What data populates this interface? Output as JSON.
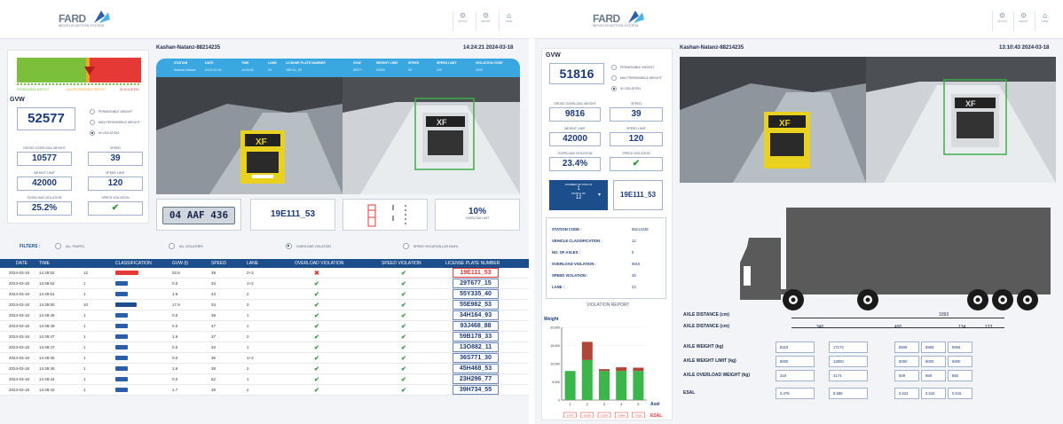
{
  "left": {
    "logo": {
      "word": "FARD",
      "sub": "WEIGH IN MOTION SYSTEM"
    },
    "nav": [
      {
        "label": "SETTING",
        "icon": "gear-icon"
      },
      {
        "label": "REPORT",
        "icon": "gear-icon"
      },
      {
        "label": "HOME",
        "icon": "home-icon"
      }
    ],
    "station_name": "Kashan-Natanz-88214235",
    "datetime": "14:24:21 2024-03-18",
    "scale": {
      "permissible": "PERMISSIBLE WEIGHT",
      "max": "MAX PERMISSIBLE WEIGHT",
      "violation": "IN VIOLATION"
    },
    "gvw_label": "GVW",
    "gvw": "52577",
    "legend": [
      "PERMISSIBLE WEIGHT",
      "MAX PERMISSIBLE WEIGHT",
      "IN VIOLATION"
    ],
    "stats": [
      {
        "label": "GROSS OVERLOAD WEIGHT",
        "value": "10577"
      },
      {
        "label": "SPEED",
        "value": "39"
      },
      {
        "label": "WEIGHT LIMIT",
        "value": "42000"
      },
      {
        "label": "SPEED LIMIT",
        "value": "120"
      },
      {
        "label": "OVERLOAD VIOLATION",
        "value": "25.2%"
      },
      {
        "label": "SPEED VIOLATION",
        "value": "✔"
      }
    ],
    "topbar": {
      "headers": [
        "STATION",
        "DATE",
        "TIME",
        "LANE",
        "LICENSE PLATE NUMBER",
        "GVW",
        "WEIGHT LIMIT",
        "SPEED",
        "SPEED LIMIT",
        "VIOLATION CODE"
      ],
      "values": [
        "Kashan-Natanz",
        "2024-03-18",
        "14:49:52",
        "23",
        "19E111_53",
        "52577",
        "42000",
        "39",
        "120",
        "2032"
      ]
    },
    "plate_image": "04 AAF 436",
    "plate_text": "19E111_53",
    "violation_pct": "10%",
    "violation_pct_label": "OVERLOAD LIMIT",
    "filters": {
      "label": "FILTERS :",
      "options": [
        "ALL TRAFFIC",
        "ALL VIOLATORS",
        "OVERLOAD VIOLATION",
        "SPEED VIOLATION (120 km/h)"
      ]
    },
    "table": {
      "headers": [
        "DATE",
        "TIME",
        "",
        "CLASSIFICATION",
        "GVW (t)",
        "SPEED",
        "LANE",
        "OVERLOAD VIOLATION",
        "SPEED VIOLATION",
        "LICENSE PLATE NUMBER"
      ],
      "rows": [
        {
          "date": "2024-03-18",
          "time": "14:49:52",
          "cls": "12",
          "gvw": "52.6",
          "speed": "39",
          "lane": "2+3",
          "ov": "x",
          "sv": "ok",
          "plate": "19E111_53",
          "hl": true,
          "v": "redv"
        },
        {
          "date": "2024-03-18",
          "time": "14:49:52",
          "cls": "1",
          "gvw": "0.0",
          "speed": "34",
          "lane": "1+2",
          "ov": "ok",
          "sv": "ok",
          "plate": "29T677_15",
          "v": "car"
        },
        {
          "date": "2024-03-18",
          "time": "14:49:51",
          "cls": "1",
          "gvw": "1.6",
          "speed": "43",
          "lane": "2",
          "ov": "ok",
          "sv": "ok",
          "plate": "55Y335_40",
          "v": "car"
        },
        {
          "date": "2024-03-18",
          "time": "14:49:50",
          "cls": "10",
          "gvw": "17.9",
          "speed": "34",
          "lane": "3",
          "ov": "ok",
          "sv": "ok",
          "plate": "55E982_53",
          "v": "truck"
        },
        {
          "date": "2024-03-18",
          "time": "14:49:49",
          "cls": "1",
          "gvw": "0.0",
          "speed": "38",
          "lane": "1",
          "ov": "ok",
          "sv": "ok",
          "plate": "34H164_93",
          "v": "car"
        },
        {
          "date": "2024-03-18",
          "time": "14:49:49",
          "cls": "1",
          "gvw": "0.0",
          "speed": "47",
          "lane": "1",
          "ov": "ok",
          "sv": "ok",
          "plate": "93J468_88",
          "v": "car"
        },
        {
          "date": "2024-03-18",
          "time": "14:49:47",
          "cls": "1",
          "gvw": "1.6",
          "speed": "37",
          "lane": "2",
          "ov": "ok",
          "sv": "ok",
          "plate": "59B178_33",
          "v": "car"
        },
        {
          "date": "2024-03-18",
          "time": "14:49:47",
          "cls": "1",
          "gvw": "0.0",
          "speed": "40",
          "lane": "1",
          "ov": "ok",
          "sv": "ok",
          "plate": "13O882_11",
          "v": "car"
        },
        {
          "date": "2024-03-18",
          "time": "14:49:45",
          "cls": "1",
          "gvw": "0.0",
          "speed": "36",
          "lane": "1+2",
          "ov": "ok",
          "sv": "ok",
          "plate": "36S771_30",
          "v": "car"
        },
        {
          "date": "2024-03-18",
          "time": "14:49:45",
          "cls": "1",
          "gvw": "1.6",
          "speed": "38",
          "lane": "2",
          "ov": "ok",
          "sv": "ok",
          "plate": "45H468_53",
          "v": "car"
        },
        {
          "date": "2024-03-18",
          "time": "14:49:44",
          "cls": "1",
          "gvw": "0.0",
          "speed": "52",
          "lane": "1",
          "ov": "ok",
          "sv": "ok",
          "plate": "23H296_77",
          "v": "car"
        },
        {
          "date": "2024-03-18",
          "time": "14:49:42",
          "cls": "1",
          "gvw": "1.7",
          "speed": "38",
          "lane": "2",
          "ov": "ok",
          "sv": "ok",
          "plate": "39H734_55",
          "v": "car"
        }
      ]
    }
  },
  "right": {
    "logo": {
      "word": "FARD",
      "sub": "WEIGH IN MOTION SYSTEM"
    },
    "nav": [
      {
        "label": "SETTING"
      },
      {
        "label": "REPORT"
      },
      {
        "label": "HOME"
      }
    ],
    "gvw_label": "GVW",
    "gvw": "51816",
    "legend": [
      "PERMISSIBLE WEIGHT",
      "MAX PERMISSIBLE WEIGHT",
      "IN VIOLATION"
    ],
    "station_name": "Kashan-Natanz-88214235",
    "datetime": "13:10:43 2024-03-18",
    "stats": [
      {
        "label": "GROSS OVERLOAD WEIGHT",
        "value": "9816"
      },
      {
        "label": "SPEED",
        "value": "39"
      },
      {
        "label": "WEIGHT LIMIT",
        "value": "42000"
      },
      {
        "label": "SPEED LIMIT",
        "value": "120"
      },
      {
        "label": "OVERLOAD VIOLATION",
        "value": "23.4%"
      },
      {
        "label": "SPEED VIOLATION",
        "value": "✔"
      }
    ],
    "axles_box": {
      "label1": "NUMBER OF PASS IN",
      "v1": "1",
      "label2": "MONTH OF",
      "v2": "12",
      "plate": "19E111_53"
    },
    "info": [
      {
        "k": "STATION CODE :",
        "v": "88214235"
      },
      {
        "k": "VEHICLE CLASSIFICATION :",
        "v": "12"
      },
      {
        "k": "NO. OF AXLES :",
        "v": "5"
      },
      {
        "k": "OVERLOAD VIOLATION :",
        "v": "9816"
      },
      {
        "k": "SPEED VIOLATION :",
        "v": "39"
      },
      {
        "k": "LANE :",
        "v": "23"
      }
    ],
    "violation_report": "VIOLATION REPORT",
    "chart_data": {
      "type": "bar",
      "title": "",
      "ylabel": "Weight",
      "xlabel": "Axel",
      "categories": [
        "1",
        "2",
        "3",
        "4",
        "5"
      ],
      "yticks": [
        "0",
        "5,000",
        "10,000",
        "15,000",
        "20,000"
      ],
      "ylim": [
        0,
        20000
      ],
      "series": [
        {
          "color": "#3cb64a",
          "values": [
            8000,
            11000,
            8000,
            8000,
            8000
          ]
        },
        {
          "color": "#b0453a",
          "values": [
            0,
            5000,
            500,
            1000,
            900
          ]
        }
      ],
      "esal_values": [
        "0.479",
        "8.699",
        "0.524",
        "0.644",
        "0.615"
      ],
      "esal_label": "ESAL"
    },
    "axle_table": {
      "axle_distance_total_label": "AXLE DISTANCE (cm)",
      "axle_distance_total": "1093",
      "rows": [
        {
          "label": "AXLE DISTANCE (cm)",
          "cells": [
            "346",
            "490",
            "134",
            "123"
          ]
        },
        {
          "label": "AXLE WEIGHT (kg)",
          "cells": [
            "8319",
            "17174",
            "8509",
            "8959",
            "8855"
          ]
        },
        {
          "label": "AXLE WEIGHT LIMIT (kg)",
          "cells": [
            "8000",
            "13000",
            "8000",
            "8000",
            "8000"
          ]
        },
        {
          "label": "AXLE OVERLOAD WEIGHT (kg)",
          "cells": [
            "319",
            "4174",
            "509",
            "959",
            "855"
          ]
        },
        {
          "label": "ESAL",
          "cells": [
            "0.479",
            "8.699",
            "0.524",
            "0.644",
            "0.615"
          ]
        }
      ]
    }
  }
}
